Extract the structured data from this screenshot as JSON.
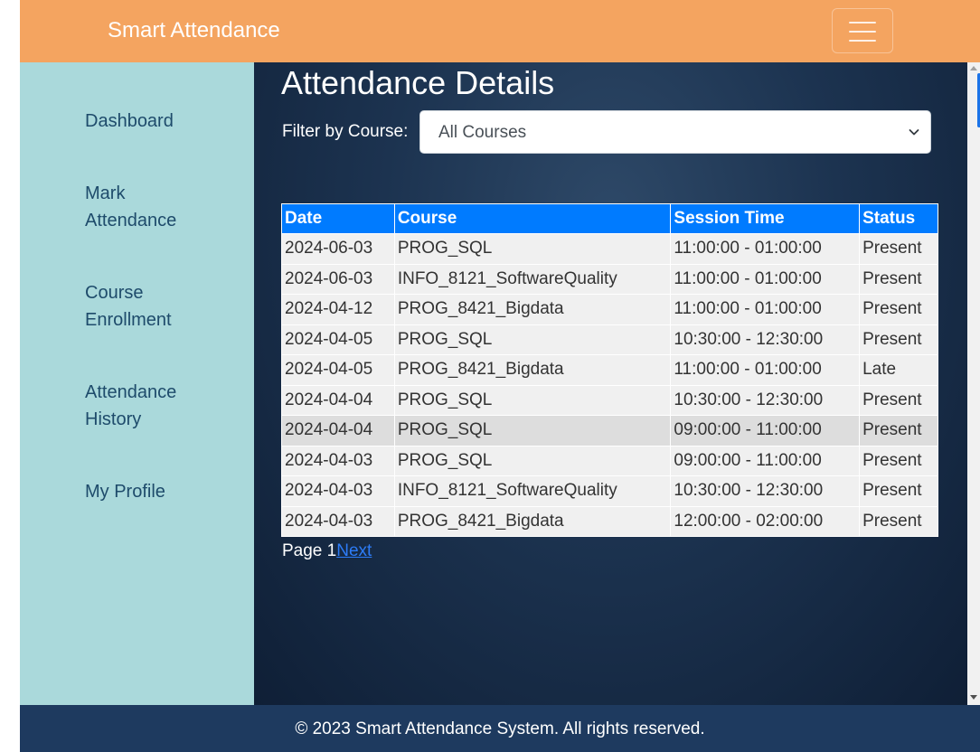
{
  "navbar": {
    "brand": "Smart Attendance",
    "toggler_icon": "hamburger-icon"
  },
  "sidebar": {
    "items": [
      {
        "label_line1": "Dashboard",
        "label_line2": ""
      },
      {
        "label_line1": "Mark",
        "label_line2": "Attendance"
      },
      {
        "label_line1": "Course",
        "label_line2": "Enrollment"
      },
      {
        "label_line1": "Attendance",
        "label_line2": "History"
      },
      {
        "label_line1": "My Profile",
        "label_line2": ""
      }
    ]
  },
  "main": {
    "title": "Attendance Details",
    "filter": {
      "label": "Filter by Course:",
      "selected": "All Courses"
    },
    "table": {
      "headers": {
        "date": "Date",
        "course": "Course",
        "session_time": "Session Time",
        "status": "Status"
      },
      "rows": [
        {
          "date": "2024-06-03",
          "course": "PROG_SQL",
          "session_time": "11:00:00 - 01:00:00",
          "status": "Present"
        },
        {
          "date": "2024-06-03",
          "course": "INFO_8121_SoftwareQuality",
          "session_time": "11:00:00 - 01:00:00",
          "status": "Present"
        },
        {
          "date": "2024-04-12",
          "course": "PROG_8421_Bigdata",
          "session_time": "11:00:00 - 01:00:00",
          "status": "Present"
        },
        {
          "date": "2024-04-05",
          "course": "PROG_SQL",
          "session_time": "10:30:00 - 12:30:00",
          "status": "Present"
        },
        {
          "date": "2024-04-05",
          "course": "PROG_8421_Bigdata",
          "session_time": "11:00:00 - 01:00:00",
          "status": "Late"
        },
        {
          "date": "2024-04-04",
          "course": "PROG_SQL",
          "session_time": "10:30:00 - 12:30:00",
          "status": "Present"
        },
        {
          "date": "2024-04-04",
          "course": "PROG_SQL",
          "session_time": "09:00:00 - 11:00:00",
          "status": "Present"
        },
        {
          "date": "2024-04-03",
          "course": "PROG_SQL",
          "session_time": "09:00:00 - 11:00:00",
          "status": "Present"
        },
        {
          "date": "2024-04-03",
          "course": "INFO_8121_SoftwareQuality",
          "session_time": "10:30:00 - 12:30:00",
          "status": "Present"
        },
        {
          "date": "2024-04-03",
          "course": "PROG_8421_Bigdata",
          "session_time": "12:00:00 - 02:00:00",
          "status": "Present"
        }
      ]
    },
    "pagination": {
      "page_label": "Page 1",
      "next_label": "Next"
    }
  },
  "footer": {
    "text": "© 2023 Smart Attendance System. All rights reserved."
  },
  "colors": {
    "navbar": "#f4a460",
    "sidebar": "#aad9db",
    "table_header": "#007bff",
    "footer": "#1e3a5f",
    "link": "#2d7cf7"
  }
}
